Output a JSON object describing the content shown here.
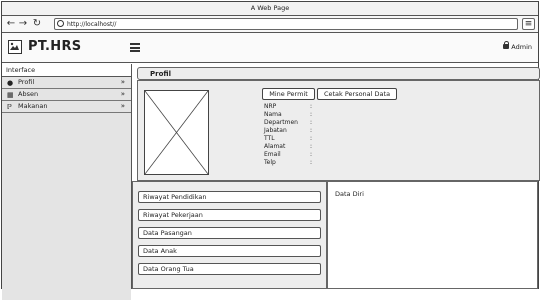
{
  "window": {
    "title": "A Web Page"
  },
  "browser": {
    "url": "http://localhost//",
    "icons": {
      "back": "arrow-left-icon",
      "forward": "arrow-right-icon",
      "reload": "reload-icon",
      "search": "search-icon",
      "menu": "hamburger-icon"
    }
  },
  "header": {
    "brand": "PT.HRS",
    "user": "Admin",
    "icons": {
      "logo": "image-icon",
      "toggle": "hamburger-icon",
      "user": "lock-icon"
    }
  },
  "sidebar": {
    "title": "Interface",
    "items": [
      {
        "label": "Profil",
        "icon": "user-icon"
      },
      {
        "label": "Absen",
        "icon": "calendar-icon"
      },
      {
        "label": "Makanan",
        "icon": "utensils-icon"
      }
    ]
  },
  "profile": {
    "title": "Profil",
    "buttons": {
      "permit": "Mine Permit",
      "print": "Cetak Personal Data"
    },
    "fields": [
      {
        "label": "NRP",
        "value": ":"
      },
      {
        "label": "Nama",
        "value": ":"
      },
      {
        "label": "Departmen",
        "value": ":"
      },
      {
        "label": "Jabatan",
        "value": ":"
      },
      {
        "label": "TTL",
        "value": ":"
      },
      {
        "label": "Alamat",
        "value": ":"
      },
      {
        "label": "Email",
        "value": ":"
      },
      {
        "label": "Telp",
        "value": ":"
      }
    ]
  },
  "sections": [
    "Riwayat Pendidikan",
    "Riwayat Pekerjaan",
    "Data Pasangan",
    "Data Anak",
    "Data Orang Tua"
  ],
  "detail": {
    "title": "Data Diri"
  }
}
